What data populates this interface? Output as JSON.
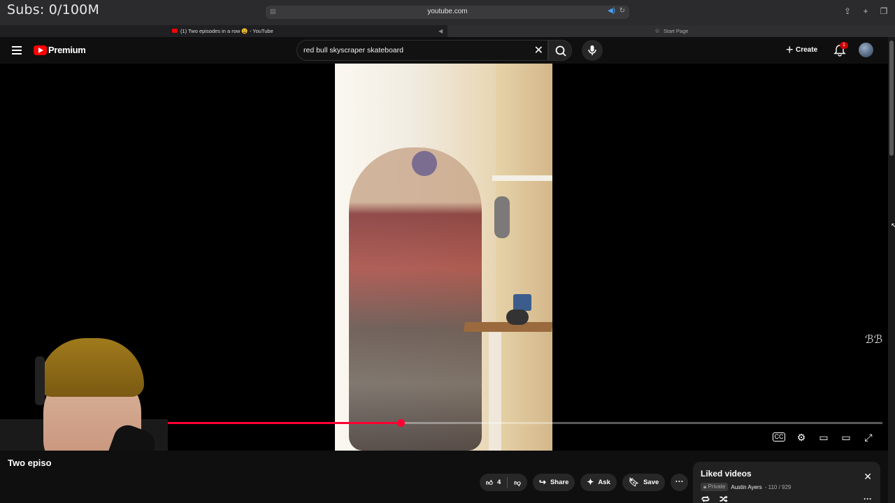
{
  "overlay": {
    "subs_counter": "Subs: 0/100M"
  },
  "browser": {
    "url": "youtube.com",
    "tabs": [
      {
        "label": "(1) Two episodes in a row 😩 - YouTube",
        "active": true
      },
      {
        "label": "Start Page",
        "active": false
      }
    ]
  },
  "header": {
    "brand": "Premium",
    "search_query": "red bull skyscraper skateboard",
    "create_label": "Create",
    "notification_count": "1"
  },
  "player": {
    "progress_fraction": 0.45,
    "watermark": "ℬℬ"
  },
  "video": {
    "title": "Two episo",
    "like_count": "4",
    "share_label": "Share",
    "ask_label": "Ask",
    "save_label": "Save"
  },
  "playlist": {
    "title": "Liked videos",
    "privacy": "Private",
    "owner": "Austin Ayers",
    "position": "- 110 / 929"
  },
  "icons": {
    "accent": "#ff0033",
    "brand_red": "#ff0000"
  }
}
